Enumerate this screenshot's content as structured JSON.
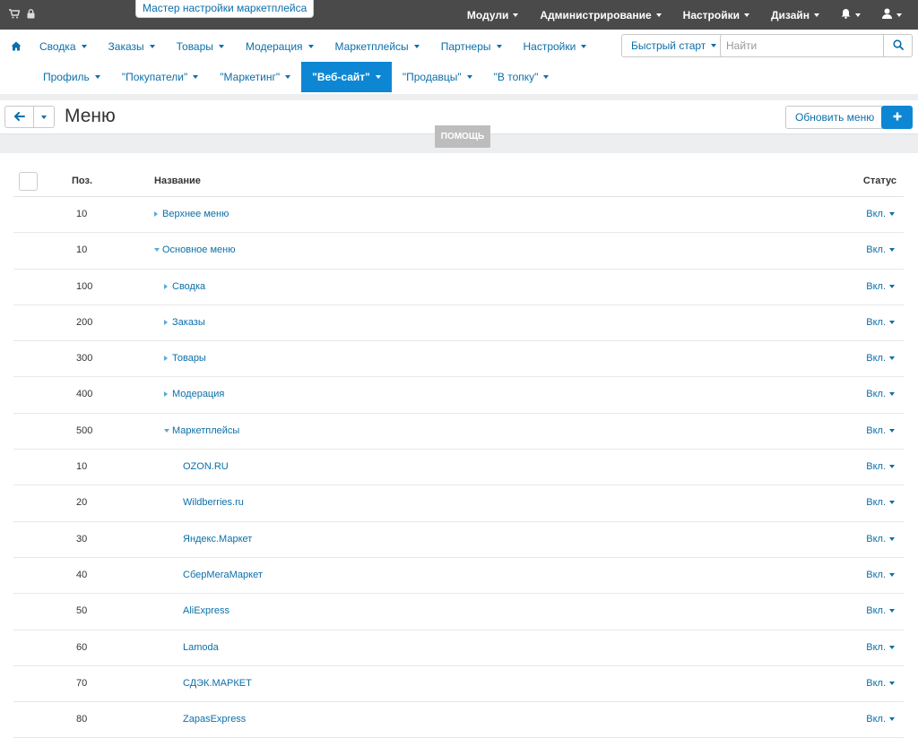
{
  "topbar": {
    "wizard_label": "Мастер настройки маркетплейса",
    "menu": [
      {
        "label": "Модули"
      },
      {
        "label": "Администрирование"
      },
      {
        "label": "Настройки"
      },
      {
        "label": "Дизайн"
      }
    ]
  },
  "nav": {
    "row1": [
      {
        "label": "Сводка"
      },
      {
        "label": "Заказы"
      },
      {
        "label": "Товары"
      },
      {
        "label": "Модерация"
      },
      {
        "label": "Маркетплейсы"
      },
      {
        "label": "Партнеры"
      },
      {
        "label": "Настройки"
      }
    ],
    "row2": [
      {
        "label": "Профиль"
      },
      {
        "label": "\"Покупатели\""
      },
      {
        "label": "\"Маркетинг\""
      },
      {
        "label": "\"Веб-сайт\"",
        "active": true
      },
      {
        "label": "\"Продавцы\""
      },
      {
        "label": "\"В топку\""
      }
    ],
    "quick_start_label": "Быстрый старт",
    "search_placeholder": "Найти"
  },
  "page": {
    "title": "Меню",
    "update_label": "Обновить меню",
    "help_label": "ПОМОЩЬ"
  },
  "table": {
    "headers": {
      "pos": "Поз.",
      "name": "Название",
      "status": "Статус"
    },
    "rows": [
      {
        "pos": "10",
        "name": "Верхнее меню",
        "level": 0,
        "toggle": "collapsed",
        "status": "Вкл."
      },
      {
        "pos": "10",
        "name": "Основное меню",
        "level": 0,
        "toggle": "expanded",
        "status": "Вкл."
      },
      {
        "pos": "100",
        "name": "Сводка",
        "level": 1,
        "toggle": "collapsed",
        "status": "Вкл."
      },
      {
        "pos": "200",
        "name": "Заказы",
        "level": 1,
        "toggle": "collapsed",
        "status": "Вкл."
      },
      {
        "pos": "300",
        "name": "Товары",
        "level": 1,
        "toggle": "collapsed",
        "status": "Вкл."
      },
      {
        "pos": "400",
        "name": "Модерация",
        "level": 1,
        "toggle": "collapsed",
        "status": "Вкл."
      },
      {
        "pos": "500",
        "name": "Маркетплейсы",
        "level": 1,
        "toggle": "expanded",
        "status": "Вкл."
      },
      {
        "pos": "10",
        "name": "OZON.RU",
        "level": 2,
        "toggle": "none",
        "status": "Вкл."
      },
      {
        "pos": "20",
        "name": "Wildberries.ru",
        "level": 2,
        "toggle": "none",
        "status": "Вкл."
      },
      {
        "pos": "30",
        "name": "Яндекс.Маркет",
        "level": 2,
        "toggle": "none",
        "status": "Вкл."
      },
      {
        "pos": "40",
        "name": "СберМегаМаркет",
        "level": 2,
        "toggle": "none",
        "status": "Вкл."
      },
      {
        "pos": "50",
        "name": "AliExpress",
        "level": 2,
        "toggle": "none",
        "status": "Вкл."
      },
      {
        "pos": "60",
        "name": "Lamoda",
        "level": 2,
        "toggle": "none",
        "status": "Вкл."
      },
      {
        "pos": "70",
        "name": "СДЭК.МАРКЕТ",
        "level": 2,
        "toggle": "none",
        "status": "Вкл."
      },
      {
        "pos": "80",
        "name": "ZapasExpress",
        "level": 2,
        "toggle": "none",
        "status": "Вкл."
      }
    ]
  },
  "colors": {
    "topbar_bg": "#4a4a4a",
    "link": "#0b6fa9",
    "accent": "#0d87d4",
    "page_gray": "#eceef0"
  }
}
